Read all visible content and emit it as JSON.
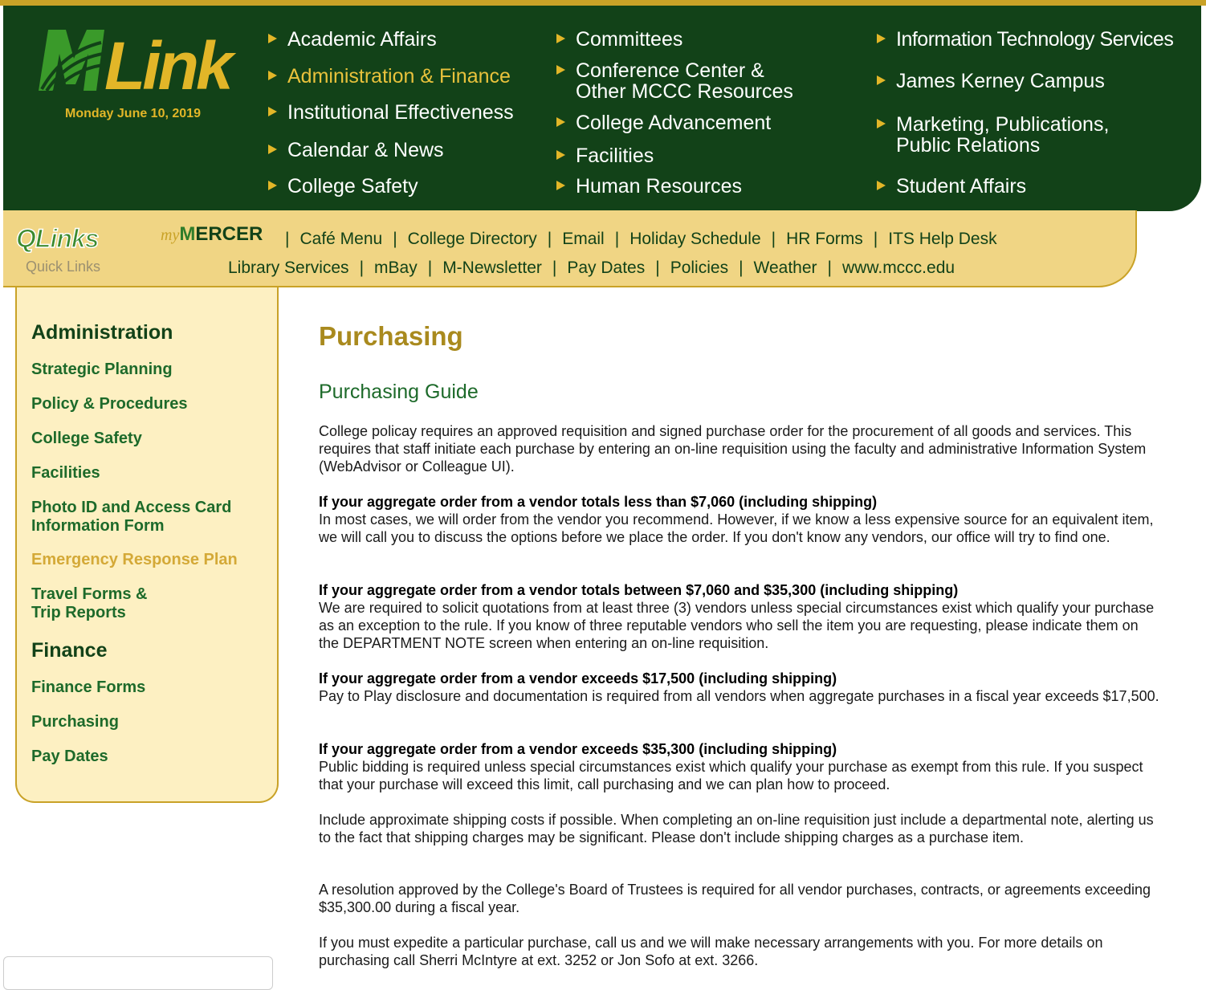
{
  "header": {
    "logo_text": "MLink",
    "date": "Monday June 10, 2019",
    "colors": {
      "dark_green": "#124218",
      "gold": "#e2b628",
      "tan": "#f0d584",
      "link_green": "#1d6a2a"
    },
    "nav_col1": [
      "Academic Affairs",
      "Administration & Finance",
      "Institutional Effectiveness",
      "Calendar & News",
      "College Safety"
    ],
    "nav_col2": [
      "Committees",
      "Conference Center &",
      "Other MCCC Resources",
      "College Advancement",
      "Facilities",
      "Human Resources"
    ],
    "nav_col3": [
      "Information Technology Services",
      "James Kerney Campus",
      "Marketing, Publications,",
      "Public Relations",
      "Student Affairs"
    ]
  },
  "quicklinks": {
    "title": "QLinks",
    "subtitle": "Quick Links",
    "mymercer_prefix": "my",
    "mymercer_text": "ERCER",
    "row1": [
      "Café Menu",
      "College Directory",
      "Email",
      "Holiday Schedule",
      "HR Forms",
      "ITS Help Desk"
    ],
    "row2": [
      "Library Services",
      "mBay",
      "M-Newsletter",
      "Pay Dates",
      "Policies",
      "Weather",
      "www.mccc.edu"
    ]
  },
  "sidebar": {
    "admin_heading": "Administration",
    "admin_links": [
      "Strategic Planning",
      "Policy & Procedures",
      "College Safety",
      "Facilities",
      "Photo ID and Access Card",
      "Information Form",
      "Emergency Response Plan",
      "Travel Forms &",
      "Trip Reports"
    ],
    "finance_heading": "Finance",
    "finance_links": [
      "Finance Forms",
      "Purchasing",
      "Pay Dates"
    ]
  },
  "main": {
    "title": "Purchasing",
    "subtitle": "Purchasing Guide",
    "intro": "College policay requires an approved requisition and signed purchase order for the procurement of all goods and services. This requires that staff initiate each purchase by entering an on-line requisition using the faculty and administrative Information System (WebAdvisor or Colleague UI).",
    "s1_head": "If your aggregate order from a vendor totals less than $7,060 (including shipping)",
    "s1_body": "In most cases, we will order from the vendor you recommend. However, if we know a less expensive source for an equivalent item, we will call you to discuss the options before we place the order. If you don't know any vendors, our office will try to find one.",
    "s2_head": "If your aggregate order from a vendor totals between $7,060 and $35,300 (including shipping)",
    "s2_body": "We are required to solicit quotations from at least three (3) vendors unless special circumstances exist which qualify your purchase as an exception to the rule. If you know of three reputable vendors who sell the item you are requesting, please indicate them on the DEPARTMENT NOTE screen when entering an on-line requisition.",
    "s3_head": "If your aggregate order from a vendor exceeds $17,500 (including shipping)",
    "s3_body": "Pay to Play disclosure and documentation is required from all vendors when aggregate purchases in a fiscal year exceeds $17,500.",
    "s4_head": "If your aggregate order from a vendor exceeds $35,300 (including shipping)",
    "s4_body": "Public bidding is required unless special circumstances exist which qualify your purchase as exempt from this rule. If you suspect that your purchase will exceed this limit, call purchasing and we can plan how to proceed.",
    "p5": "Include approximate shipping costs if possible. When completing an on-line requisition just include a departmental note, alerting us to the fact that shipping charges may be significant. Please don't include shipping charges as a purchase item.",
    "p6": "A resolution approved by the College's Board of Trustees is required for all vendor purchases, contracts, or agreements exceeding $35,300.00 during a fiscal year.",
    "p7": "If you must expedite a particular purchase, call us and we will make necessary arrangements with you. For more details on purchasing call Sherri McIntyre at ext. 3252 or Jon Sofo at ext. 3266."
  }
}
